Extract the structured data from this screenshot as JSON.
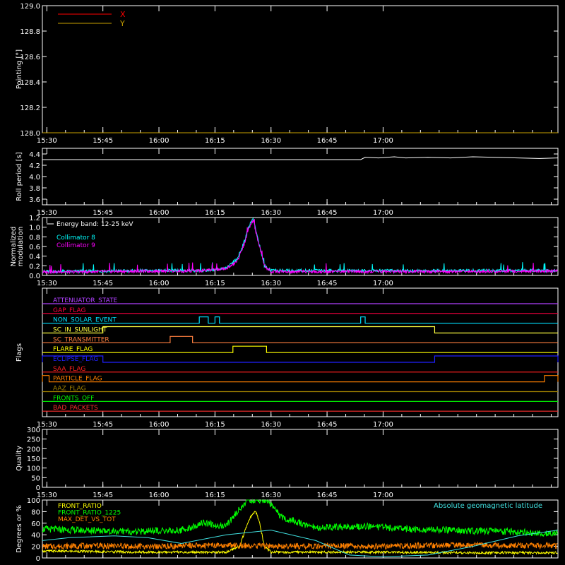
{
  "time_ticks": [
    "15:30",
    "15:45",
    "16:00",
    "16:15",
    "16:30",
    "16:45",
    "17:00"
  ],
  "chart_data": [
    {
      "type": "line",
      "ylabel": "Pointing [°]",
      "ylim": [
        128.0,
        129.0
      ],
      "y_ticks": [
        "129.0",
        "128.8",
        "128.6",
        "128.4",
        "128.2",
        "128.0"
      ],
      "legend": [
        {
          "name": "X",
          "color": "#ff0000"
        },
        {
          "name": "Y",
          "color": "#c8a000"
        }
      ],
      "series": [
        {
          "name": "X",
          "color": "#ff0000",
          "x": [],
          "values": []
        },
        {
          "name": "Y",
          "color": "#c8a000",
          "x": [
            15.48,
            17.78
          ],
          "values": [
            128.0,
            128.0
          ]
        }
      ]
    },
    {
      "type": "line",
      "ylabel": "Roll period [s]",
      "ylim": [
        3.5,
        4.5
      ],
      "y_ticks": [
        "4.4",
        "4.2",
        "4.0",
        "3.8",
        "3.6"
      ],
      "series": [
        {
          "name": "Roll period",
          "color": "#ffffff",
          "x": [
            15.48,
            16.9,
            16.92,
            16.98,
            17.05,
            17.1,
            17.2,
            17.3,
            17.4,
            17.5,
            17.6,
            17.7,
            17.78
          ],
          "values": [
            4.3,
            4.3,
            4.34,
            4.33,
            4.35,
            4.33,
            4.34,
            4.33,
            4.35,
            4.34,
            4.33,
            4.32,
            4.33
          ]
        }
      ]
    },
    {
      "type": "line",
      "ylabel": "Normalized modulation",
      "ylim": [
        0.0,
        1.2
      ],
      "y_ticks": [
        "1.2",
        "1.0",
        "0.8",
        "0.6",
        "0.4",
        "0.2",
        "0.0"
      ],
      "annotation": "Energy band: 12-25 keV",
      "legend": [
        {
          "name": "Collimator 8",
          "color": "#00ffff"
        },
        {
          "name": "Collimator 9",
          "color": "#ff00ff"
        }
      ],
      "series": [
        {
          "name": "Collimator 8",
          "color": "#00ffff",
          "x": [
            15.48,
            16.0,
            16.1,
            16.2,
            16.3,
            16.35,
            16.38,
            16.4,
            16.42,
            16.44,
            16.47,
            16.5,
            16.6,
            17.0,
            17.78
          ],
          "values": [
            0.08,
            0.1,
            0.1,
            0.1,
            0.15,
            0.35,
            0.7,
            1.0,
            1.2,
            0.8,
            0.2,
            0.1,
            0.1,
            0.1,
            0.1
          ]
        },
        {
          "name": "Collimator 9",
          "color": "#ff00ff",
          "x": [
            15.48,
            16.0,
            16.1,
            16.2,
            16.3,
            16.35,
            16.38,
            16.4,
            16.42,
            16.44,
            16.47,
            16.5,
            16.6,
            17.0,
            17.78
          ],
          "values": [
            0.07,
            0.09,
            0.09,
            0.1,
            0.14,
            0.3,
            0.65,
            0.95,
            1.15,
            0.75,
            0.2,
            0.08,
            0.08,
            0.08,
            0.09
          ]
        }
      ]
    },
    {
      "type": "line",
      "ylabel": "Flags",
      "flags": [
        {
          "name": "ATTENUATOR_STATE",
          "color": "#b040ff",
          "on_intervals": []
        },
        {
          "name": "GAP_FLAG",
          "color": "#ff0040",
          "on_intervals": []
        },
        {
          "name": "NON_SOLAR_EVENT",
          "color": "#00e0ff",
          "on_intervals": [
            [
              16.18,
              16.22
            ],
            [
              16.25,
              16.27
            ],
            [
              16.9,
              16.92
            ]
          ]
        },
        {
          "name": "SC_IN_SUNLIGHT",
          "color": "#ffff40",
          "on_intervals": [
            [
              15.75,
              17.23
            ]
          ]
        },
        {
          "name": "SC_TRANSMITTER",
          "color": "#ff8040",
          "on_intervals": [
            [
              16.05,
              16.15
            ]
          ]
        },
        {
          "name": "FLARE_FLAG",
          "color": "#ffff00",
          "on_intervals": [
            [
              16.33,
              16.48
            ]
          ]
        },
        {
          "name": "ECLIPSE_FLAG",
          "color": "#2020ff",
          "on_intervals": [
            [
              15.48,
              15.75
            ],
            [
              17.23,
              17.78
            ]
          ]
        },
        {
          "name": "SAA_FLAG",
          "color": "#ff2020",
          "on_intervals": []
        },
        {
          "name": "PARTICLE_FLAG",
          "color": "#ff8000",
          "on_intervals": [
            [
              15.48,
              15.51
            ],
            [
              17.72,
              17.78
            ]
          ]
        },
        {
          "name": "AAZ_FLAG",
          "color": "#a08000",
          "on_intervals": []
        },
        {
          "name": "FRONTS_OFF",
          "color": "#00ff00",
          "on_intervals": []
        },
        {
          "name": "BAD_PACKETS",
          "color": "#ff3030",
          "on_intervals": []
        }
      ]
    },
    {
      "type": "line",
      "ylabel": "Quality",
      "ylim": [
        0,
        300
      ],
      "y_ticks": [
        "300",
        "250",
        "200",
        "150",
        "100",
        "50",
        "0"
      ],
      "series": []
    },
    {
      "type": "line",
      "ylabel": "Degrees or %",
      "ylim": [
        0,
        100
      ],
      "y_ticks": [
        "100",
        "80",
        "60",
        "40",
        "20",
        "0"
      ],
      "annotation": "Absolute geomagnetic latitude",
      "legend": [
        {
          "name": "FRONT_RATIO",
          "color": "#ffff00"
        },
        {
          "name": "FRONT_RATIO_1225",
          "color": "#00ff00"
        },
        {
          "name": "MAX_DET_VS_TOT",
          "color": "#ff8000"
        }
      ],
      "series": [
        {
          "name": "FRONT_RATIO_1225",
          "color": "#00ff00",
          "x": [
            15.48,
            15.7,
            15.9,
            16.1,
            16.2,
            16.3,
            16.35,
            16.4,
            16.48,
            16.55,
            16.7,
            16.9,
            17.1,
            17.3,
            17.5,
            17.78
          ],
          "values": [
            50,
            47,
            46,
            48,
            60,
            55,
            80,
            100,
            100,
            70,
            52,
            55,
            50,
            48,
            46,
            42
          ]
        },
        {
          "name": "FRONT_RATIO",
          "color": "#ffff00",
          "x": [
            15.48,
            15.7,
            16.0,
            16.3,
            16.36,
            16.4,
            16.43,
            16.45,
            16.47,
            16.5,
            16.7,
            17.0,
            17.3,
            17.78
          ],
          "values": [
            12,
            11,
            10,
            10,
            20,
            65,
            82,
            60,
            20,
            10,
            10,
            10,
            9,
            9
          ]
        },
        {
          "name": "MAX_DET_VS_TOT",
          "color": "#ff8000",
          "x": [
            15.48,
            15.7,
            16.0,
            16.3,
            16.5,
            16.7,
            17.0,
            17.3,
            17.78
          ],
          "values": [
            20,
            21,
            20,
            22,
            20,
            21,
            20,
            22,
            21
          ]
        },
        {
          "name": "Absolute geomagnetic latitude",
          "color": "#40e0e0",
          "x": [
            15.48,
            15.6,
            15.8,
            15.95,
            16.1,
            16.3,
            16.5,
            16.7,
            16.85,
            17.0,
            17.2,
            17.4,
            17.6,
            17.78
          ],
          "values": [
            30,
            35,
            38,
            35,
            25,
            40,
            48,
            30,
            5,
            2,
            5,
            20,
            38,
            48
          ]
        }
      ]
    }
  ]
}
